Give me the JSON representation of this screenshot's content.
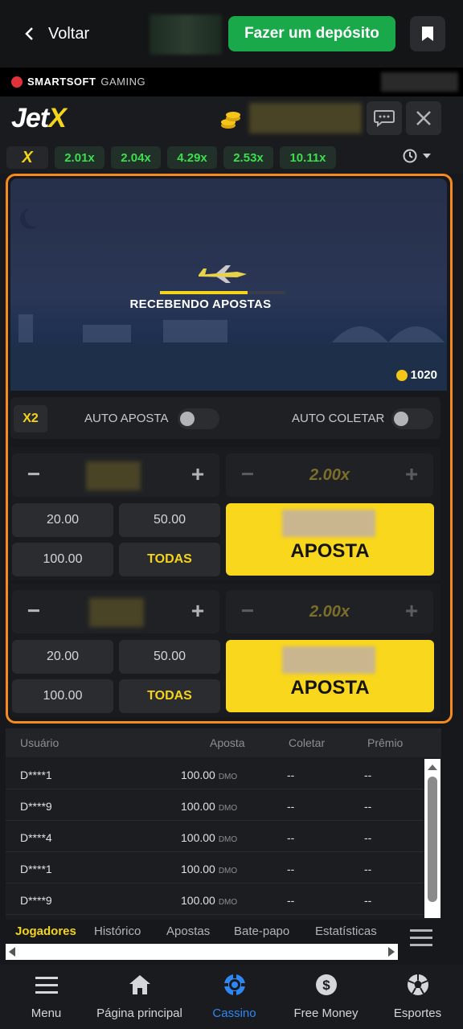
{
  "topbar": {
    "back_label": "Voltar",
    "deposit_label": "Fazer um depósito"
  },
  "brand": {
    "name": "SMARTSOFT",
    "suffix": "GAMING"
  },
  "game": {
    "logo_main": "Jet",
    "logo_x": "X",
    "multipliers": [
      "2.01x",
      "2.04x",
      "4.29x",
      "2.53x",
      "10.11x"
    ],
    "stage_status": "RECEBENDO APOSTAS",
    "progress_fraction": 0.7,
    "players_count": "1020",
    "x2_label": "X2",
    "auto_bet_label": "AUTO APOSTA",
    "auto_collect_label": "AUTO COLETAR",
    "panels": [
      {
        "multiplier": "2.00x",
        "quick": [
          "20.00",
          "50.00",
          "100.00",
          "TODAS"
        ],
        "bet_label": "APOSTA"
      },
      {
        "multiplier": "2.00x",
        "quick": [
          "20.00",
          "50.00",
          "100.00",
          "TODAS"
        ],
        "bet_label": "APOSTA"
      }
    ],
    "stepper_minus": "−",
    "stepper_plus": "+"
  },
  "table": {
    "headers": {
      "user": "Usuário",
      "bet": "Aposta",
      "collect": "Coletar",
      "prize": "Prêmio"
    },
    "rows": [
      {
        "user": "D****1",
        "bet": "100.00",
        "currency": "DMO",
        "collect": "--",
        "prize": "--"
      },
      {
        "user": "D****9",
        "bet": "100.00",
        "currency": "DMO",
        "collect": "--",
        "prize": "--"
      },
      {
        "user": "D****4",
        "bet": "100.00",
        "currency": "DMO",
        "collect": "--",
        "prize": "--"
      },
      {
        "user": "D****1",
        "bet": "100.00",
        "currency": "DMO",
        "collect": "--",
        "prize": "--"
      },
      {
        "user": "D****9",
        "bet": "100.00",
        "currency": "DMO",
        "collect": "--",
        "prize": "--"
      }
    ]
  },
  "tabs": [
    "Jogadores",
    "Histórico",
    "Apostas",
    "Bate-papo",
    "Estatísticas"
  ],
  "bottom_nav": [
    {
      "label": "Menu",
      "icon": "menu-icon"
    },
    {
      "label": "Página principal",
      "icon": "home-icon"
    },
    {
      "label": "Cassino",
      "icon": "casino-chip-icon"
    },
    {
      "label": "Free Money",
      "icon": "dollar-coin-icon"
    },
    {
      "label": "Esportes",
      "icon": "soccer-ball-icon"
    }
  ],
  "colors": {
    "accent_yellow": "#f9d71c",
    "deposit_green": "#1aa94a",
    "multiplier_green": "#3bde4c",
    "frame_orange": "#f58a1f",
    "active_blue": "#2f86f5"
  }
}
